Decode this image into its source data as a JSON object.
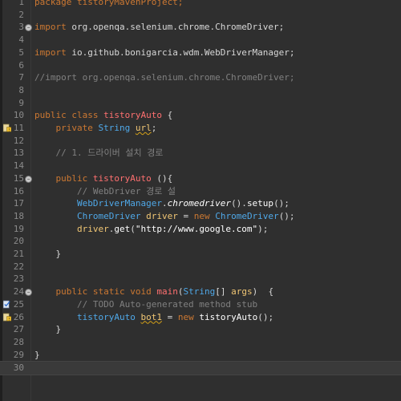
{
  "lines": [
    {
      "n": "1",
      "segs": [
        {
          "t": "package tistoryMavenProject;",
          "c": "kw"
        }
      ]
    },
    {
      "n": "2",
      "segs": []
    },
    {
      "n": "3",
      "fold": true,
      "segs": [
        {
          "t": "import",
          "c": "kw"
        },
        {
          "t": " org.openqa.selenium.chrome.ChromeDriver;",
          "c": "str"
        }
      ]
    },
    {
      "n": "4",
      "segs": []
    },
    {
      "n": "5",
      "segs": [
        {
          "t": "import",
          "c": "kw"
        },
        {
          "t": " io.github.bonigarcia.wdm.WebDriverManager;",
          "c": "str"
        }
      ]
    },
    {
      "n": "6",
      "segs": []
    },
    {
      "n": "7",
      "segs": [
        {
          "t": "//import org.openqa.selenium.chrome.ChromeDriver;",
          "c": "cmt"
        }
      ]
    },
    {
      "n": "8",
      "segs": []
    },
    {
      "n": "9",
      "segs": []
    },
    {
      "n": "10",
      "segs": [
        {
          "t": "public class ",
          "c": "kw"
        },
        {
          "t": "tistoryAuto",
          "c": "pink"
        },
        {
          "t": " {",
          "c": "str"
        }
      ]
    },
    {
      "n": "11",
      "marker": "warning",
      "segs": [
        {
          "t": "    private ",
          "c": "kw"
        },
        {
          "t": "String",
          "c": "type"
        },
        {
          "t": " ",
          "c": "str"
        },
        {
          "t": "url",
          "c": "field squig"
        },
        {
          "t": ";",
          "c": "str"
        }
      ]
    },
    {
      "n": "12",
      "segs": []
    },
    {
      "n": "13",
      "segs": [
        {
          "t": "    // 1. 드라이버 설치 경로",
          "c": "cmt"
        }
      ]
    },
    {
      "n": "14",
      "segs": []
    },
    {
      "n": "15",
      "fold": true,
      "segs": [
        {
          "t": "    public ",
          "c": "kw"
        },
        {
          "t": "tistoryAuto",
          "c": "pink"
        },
        {
          "t": " (){",
          "c": "str"
        }
      ]
    },
    {
      "n": "16",
      "segs": [
        {
          "t": "        // WebDriver 경로 설",
          "c": "cmt"
        }
      ]
    },
    {
      "n": "17",
      "segs": [
        {
          "t": "        WebDriverManager",
          "c": "type"
        },
        {
          "t": ".",
          "c": "str"
        },
        {
          "t": "chromedriver",
          "c": "italic"
        },
        {
          "t": "().",
          "c": "str"
        },
        {
          "t": "setup",
          "c": "method"
        },
        {
          "t": "();",
          "c": "str"
        }
      ]
    },
    {
      "n": "18",
      "segs": [
        {
          "t": "        ChromeDriver",
          "c": "type"
        },
        {
          "t": " ",
          "c": "str"
        },
        {
          "t": "driver",
          "c": "var"
        },
        {
          "t": " = ",
          "c": "str"
        },
        {
          "t": "new",
          "c": "kw"
        },
        {
          "t": " ",
          "c": "str"
        },
        {
          "t": "ChromeDriver",
          "c": "type"
        },
        {
          "t": "();",
          "c": "str"
        }
      ]
    },
    {
      "n": "19",
      "segs": [
        {
          "t": "        driver",
          "c": "var"
        },
        {
          "t": ".",
          "c": "str"
        },
        {
          "t": "get",
          "c": "method"
        },
        {
          "t": "(",
          "c": "str"
        },
        {
          "t": "\"http://www.google.com\"",
          "c": "method"
        },
        {
          "t": ");",
          "c": "str"
        }
      ]
    },
    {
      "n": "20",
      "segs": []
    },
    {
      "n": "21",
      "segs": [
        {
          "t": "    }",
          "c": "str"
        }
      ]
    },
    {
      "n": "22",
      "segs": []
    },
    {
      "n": "23",
      "segs": []
    },
    {
      "n": "24",
      "fold": true,
      "segs": [
        {
          "t": "    public static void ",
          "c": "kw"
        },
        {
          "t": "main",
          "c": "pink"
        },
        {
          "t": "(",
          "c": "str"
        },
        {
          "t": "String",
          "c": "type"
        },
        {
          "t": "[] ",
          "c": "str"
        },
        {
          "t": "args",
          "c": "var"
        },
        {
          "t": ")  {",
          "c": "str"
        }
      ]
    },
    {
      "n": "25",
      "marker": "task",
      "segs": [
        {
          "t": "        // TODO Auto-generated method stub",
          "c": "cmt"
        }
      ]
    },
    {
      "n": "26",
      "marker": "warning",
      "segs": [
        {
          "t": "        tistoryAuto",
          "c": "type"
        },
        {
          "t": " ",
          "c": "str"
        },
        {
          "t": "bot1",
          "c": "var squig"
        },
        {
          "t": " = ",
          "c": "str"
        },
        {
          "t": "new",
          "c": "kw"
        },
        {
          "t": " ",
          "c": "str"
        },
        {
          "t": "tistoryAuto",
          "c": "method"
        },
        {
          "t": "();",
          "c": "str"
        }
      ]
    },
    {
      "n": "27",
      "segs": [
        {
          "t": "    }",
          "c": "str"
        }
      ]
    },
    {
      "n": "28",
      "segs": []
    },
    {
      "n": "29",
      "segs": [
        {
          "t": "}",
          "c": "str"
        }
      ]
    },
    {
      "n": "30",
      "current": true,
      "segs": []
    }
  ],
  "colors": {
    "background": "#2f2f2f",
    "keyword": "#cc7832",
    "type": "#4fa8e8",
    "variable": "#f0c674",
    "comment": "#808080",
    "warning": "#d4a017"
  }
}
